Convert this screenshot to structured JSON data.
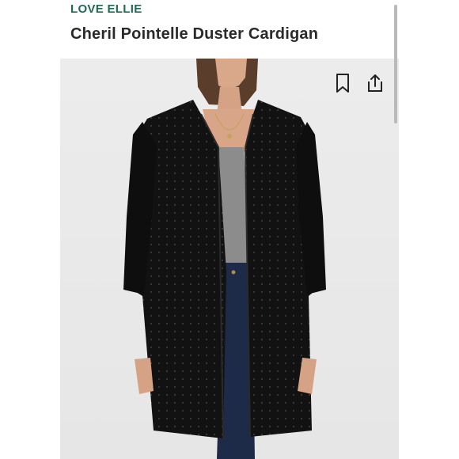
{
  "product": {
    "brand": "LOVE ELLIE",
    "title": "Cheril Pointelle Duster Cardigan"
  },
  "icons": {
    "bookmark": "bookmark-icon",
    "share": "share-icon"
  },
  "colors": {
    "brand": "#1e6b4f",
    "title": "#2a2a2a",
    "background": "#e8e8e8",
    "cardigan": "#111111"
  }
}
